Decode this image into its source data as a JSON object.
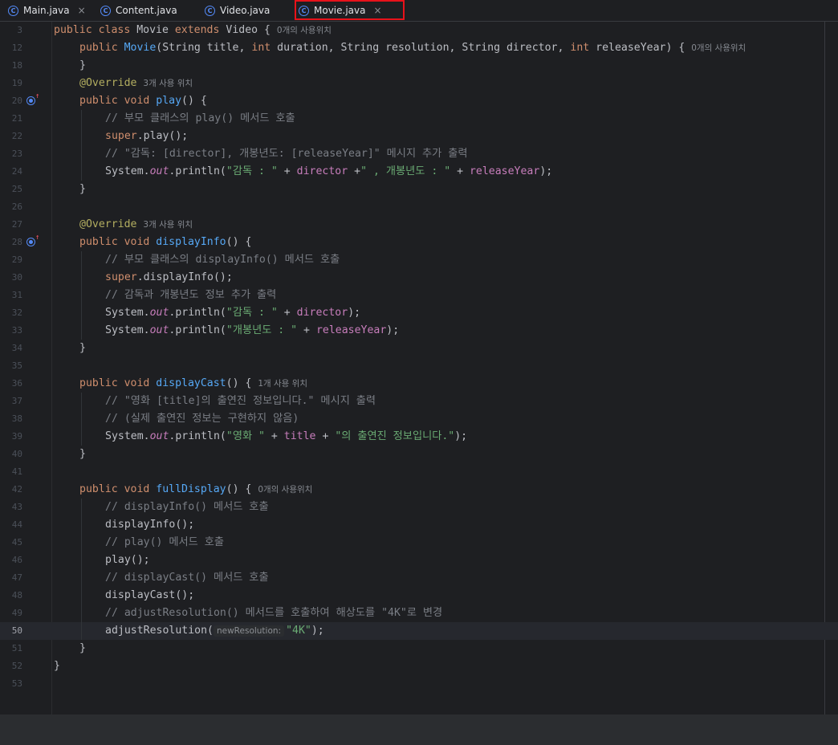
{
  "tabs": [
    {
      "label": "Main.java",
      "icon": "java-main-class-icon",
      "closable": true
    },
    {
      "label": "Content.java",
      "icon": "java-class-icon",
      "closable": false
    },
    {
      "label": "Video.java",
      "icon": "java-class-icon",
      "closable": false
    },
    {
      "label": "Movie.java",
      "icon": "java-class-icon",
      "closable": true,
      "active": true
    }
  ],
  "close_glyph": "×",
  "current_line": "50",
  "colors": {
    "keyword": "#cf8e6d",
    "function": "#56a8f5",
    "comment": "#7a7e85",
    "string": "#6aab73",
    "field": "#c77dbb",
    "annotation": "#b3ae60",
    "highlight_box": "#e8121a"
  },
  "lines": [
    {
      "n": "3",
      "indent": 0,
      "tokens": [
        [
          "k",
          "public class "
        ],
        [
          "",
          "Movie "
        ],
        [
          "k",
          "extends "
        ],
        [
          "",
          "Video { "
        ],
        [
          "hint",
          "0개의 사용위치"
        ]
      ]
    },
    {
      "n": "12",
      "indent": 1,
      "tokens": [
        [
          "k",
          "public "
        ],
        [
          "f",
          "Movie"
        ],
        [
          "",
          "(String title, "
        ],
        [
          "k",
          "int "
        ],
        [
          "",
          "duration, String resolution, String director, "
        ],
        [
          "k",
          "int "
        ],
        [
          "",
          "releaseYear) { "
        ],
        [
          "hint",
          "0개의 사용위치"
        ]
      ]
    },
    {
      "n": "18",
      "indent": 1,
      "tokens": [
        [
          "",
          "}"
        ]
      ]
    },
    {
      "n": "19",
      "indent": 1,
      "tokens": [
        [
          "a",
          "@Override "
        ],
        [
          "hint",
          "3개 사용 위치"
        ]
      ]
    },
    {
      "n": "20",
      "indent": 1,
      "gutter": "override-icon",
      "tokens": [
        [
          "k",
          "public void "
        ],
        [
          "f",
          "play"
        ],
        [
          "",
          "() {"
        ]
      ]
    },
    {
      "n": "21",
      "indent": 2,
      "tokens": [
        [
          "c",
          "// 부모 클래스의 play() 메서드 호출"
        ]
      ]
    },
    {
      "n": "22",
      "indent": 2,
      "tokens": [
        [
          "k",
          "super"
        ],
        [
          "",
          ".play();"
        ]
      ]
    },
    {
      "n": "23",
      "indent": 2,
      "tokens": [
        [
          "c",
          "// \"감독: [director], 개봉년도: [releaseYear]\" 메시지 추가 출력"
        ]
      ]
    },
    {
      "n": "24",
      "indent": 2,
      "tokens": [
        [
          "",
          "System."
        ],
        [
          "st",
          "out"
        ],
        [
          "",
          ".println("
        ],
        [
          "s",
          "\"감독 : \""
        ],
        [
          "",
          " + "
        ],
        [
          "fld",
          "director"
        ],
        [
          "",
          " +"
        ],
        [
          "s",
          "\" , 개봉년도 : \""
        ],
        [
          "",
          " + "
        ],
        [
          "fld",
          "releaseYear"
        ],
        [
          "",
          ");"
        ]
      ]
    },
    {
      "n": "25",
      "indent": 1,
      "tokens": [
        [
          "",
          "}"
        ]
      ]
    },
    {
      "n": "26",
      "indent": 0,
      "tokens": []
    },
    {
      "n": "27",
      "indent": 1,
      "tokens": [
        [
          "a",
          "@Override "
        ],
        [
          "hint",
          "3개 사용 위치"
        ]
      ]
    },
    {
      "n": "28",
      "indent": 1,
      "gutter": "override-icon",
      "tokens": [
        [
          "k",
          "public void "
        ],
        [
          "f",
          "displayInfo"
        ],
        [
          "",
          "() {"
        ]
      ]
    },
    {
      "n": "29",
      "indent": 2,
      "tokens": [
        [
          "c",
          "// 부모 클래스의 displayInfo() 메서드 호출"
        ]
      ]
    },
    {
      "n": "30",
      "indent": 2,
      "tokens": [
        [
          "k",
          "super"
        ],
        [
          "",
          ".displayInfo();"
        ]
      ]
    },
    {
      "n": "31",
      "indent": 2,
      "tokens": [
        [
          "c",
          "// 감독과 개봉년도 정보 추가 출력"
        ]
      ]
    },
    {
      "n": "32",
      "indent": 2,
      "tokens": [
        [
          "",
          "System."
        ],
        [
          "st",
          "out"
        ],
        [
          "",
          ".println("
        ],
        [
          "s",
          "\"감독 : \""
        ],
        [
          "",
          " + "
        ],
        [
          "fld",
          "director"
        ],
        [
          "",
          ");"
        ]
      ]
    },
    {
      "n": "33",
      "indent": 2,
      "tokens": [
        [
          "",
          "System."
        ],
        [
          "st",
          "out"
        ],
        [
          "",
          ".println("
        ],
        [
          "s",
          "\"개봉년도 : \""
        ],
        [
          "",
          " + "
        ],
        [
          "fld",
          "releaseYear"
        ],
        [
          "",
          ");"
        ]
      ]
    },
    {
      "n": "34",
      "indent": 1,
      "tokens": [
        [
          "",
          "}"
        ]
      ]
    },
    {
      "n": "35",
      "indent": 0,
      "tokens": []
    },
    {
      "n": "36",
      "indent": 1,
      "tokens": [
        [
          "k",
          "public void "
        ],
        [
          "f",
          "displayCast"
        ],
        [
          "",
          "() { "
        ],
        [
          "hint",
          "1개 사용 위치"
        ]
      ]
    },
    {
      "n": "37",
      "indent": 2,
      "tokens": [
        [
          "c",
          "// \"영화 [title]의 출연진 정보입니다.\" 메시지 출력"
        ]
      ]
    },
    {
      "n": "38",
      "indent": 2,
      "tokens": [
        [
          "c",
          "// (실제 출연진 정보는 구현하지 않음)"
        ]
      ]
    },
    {
      "n": "39",
      "indent": 2,
      "tokens": [
        [
          "",
          "System."
        ],
        [
          "st",
          "out"
        ],
        [
          "",
          ".println("
        ],
        [
          "s",
          "\"영화 \""
        ],
        [
          "",
          " + "
        ],
        [
          "fld",
          "title"
        ],
        [
          "",
          " + "
        ],
        [
          "s",
          "\"의 출연진 정보입니다.\""
        ],
        [
          "",
          ");"
        ]
      ]
    },
    {
      "n": "40",
      "indent": 1,
      "tokens": [
        [
          "",
          "}"
        ]
      ]
    },
    {
      "n": "41",
      "indent": 0,
      "tokens": []
    },
    {
      "n": "42",
      "indent": 1,
      "tokens": [
        [
          "k",
          "public void "
        ],
        [
          "f",
          "fullDisplay"
        ],
        [
          "",
          "() { "
        ],
        [
          "hint",
          "0개의 사용위치"
        ]
      ]
    },
    {
      "n": "43",
      "indent": 2,
      "tokens": [
        [
          "c",
          "// displayInfo() 메서드 호출"
        ]
      ]
    },
    {
      "n": "44",
      "indent": 2,
      "tokens": [
        [
          "",
          "displayInfo();"
        ]
      ]
    },
    {
      "n": "45",
      "indent": 2,
      "tokens": [
        [
          "c",
          "// play() 메서드 호출"
        ]
      ]
    },
    {
      "n": "46",
      "indent": 2,
      "tokens": [
        [
          "",
          "play();"
        ]
      ]
    },
    {
      "n": "47",
      "indent": 2,
      "tokens": [
        [
          "c",
          "// displayCast() 메서드 호출"
        ]
      ]
    },
    {
      "n": "48",
      "indent": 2,
      "tokens": [
        [
          "",
          "displayCast();"
        ]
      ]
    },
    {
      "n": "49",
      "indent": 2,
      "tokens": [
        [
          "c",
          "// adjustResolution() 메서드를 호출하여 해상도를 \"4K\"로 변경"
        ]
      ]
    },
    {
      "n": "50",
      "indent": 2,
      "tokens": [
        [
          "",
          "adjustResolution("
        ],
        [
          "phint",
          "newResolution:"
        ],
        [
          "s",
          "\"4K\""
        ],
        [
          "",
          ");"
        ]
      ]
    },
    {
      "n": "51",
      "indent": 1,
      "tokens": [
        [
          "",
          "}"
        ]
      ]
    },
    {
      "n": "52",
      "indent": 0,
      "tokens": [
        [
          "",
          "}"
        ]
      ]
    },
    {
      "n": "53",
      "indent": 0,
      "tokens": []
    }
  ]
}
